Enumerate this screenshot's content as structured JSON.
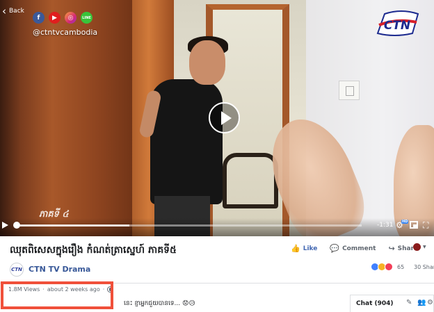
{
  "video": {
    "back_label": "Back",
    "social_handle": "@ctntvcambodia",
    "social_icons": [
      "facebook-icon",
      "youtube-icon",
      "instagram-icon",
      "line-icon"
    ],
    "brand_logo_text": "CTN",
    "episode_overlay": "ភាគទី ៤",
    "time_remaining": "-1:31",
    "hd_badge": "HD",
    "progress_fraction": 0.33,
    "buffer_fraction": 0.33
  },
  "post": {
    "title": "ឈុតពិសេសក្នុងរឿង កំណត់ត្រាស្នេហ៍ ភាគទី៥",
    "actions": [
      {
        "label": "Like",
        "icon": "thumbs-up-icon"
      },
      {
        "label": "Comment",
        "icon": "comment-icon"
      },
      {
        "label": "Share",
        "icon": "share-icon"
      }
    ],
    "page_name": "CTN TV Drama",
    "page_logo_text": "CTN",
    "reaction_count": "65",
    "shares_label": "30 Shar",
    "views": "1.8M Views",
    "time_ago": "about 2 weeks ago",
    "separator": "·",
    "description": "នេះ ខ្ញាអ្នកជួយបានទេ... 😟😥"
  },
  "chat": {
    "label": "Chat (904)"
  },
  "colors": {
    "facebook_blue": "#4267b2",
    "highlight_red": "#f0503a",
    "link_blue": "#385898"
  }
}
